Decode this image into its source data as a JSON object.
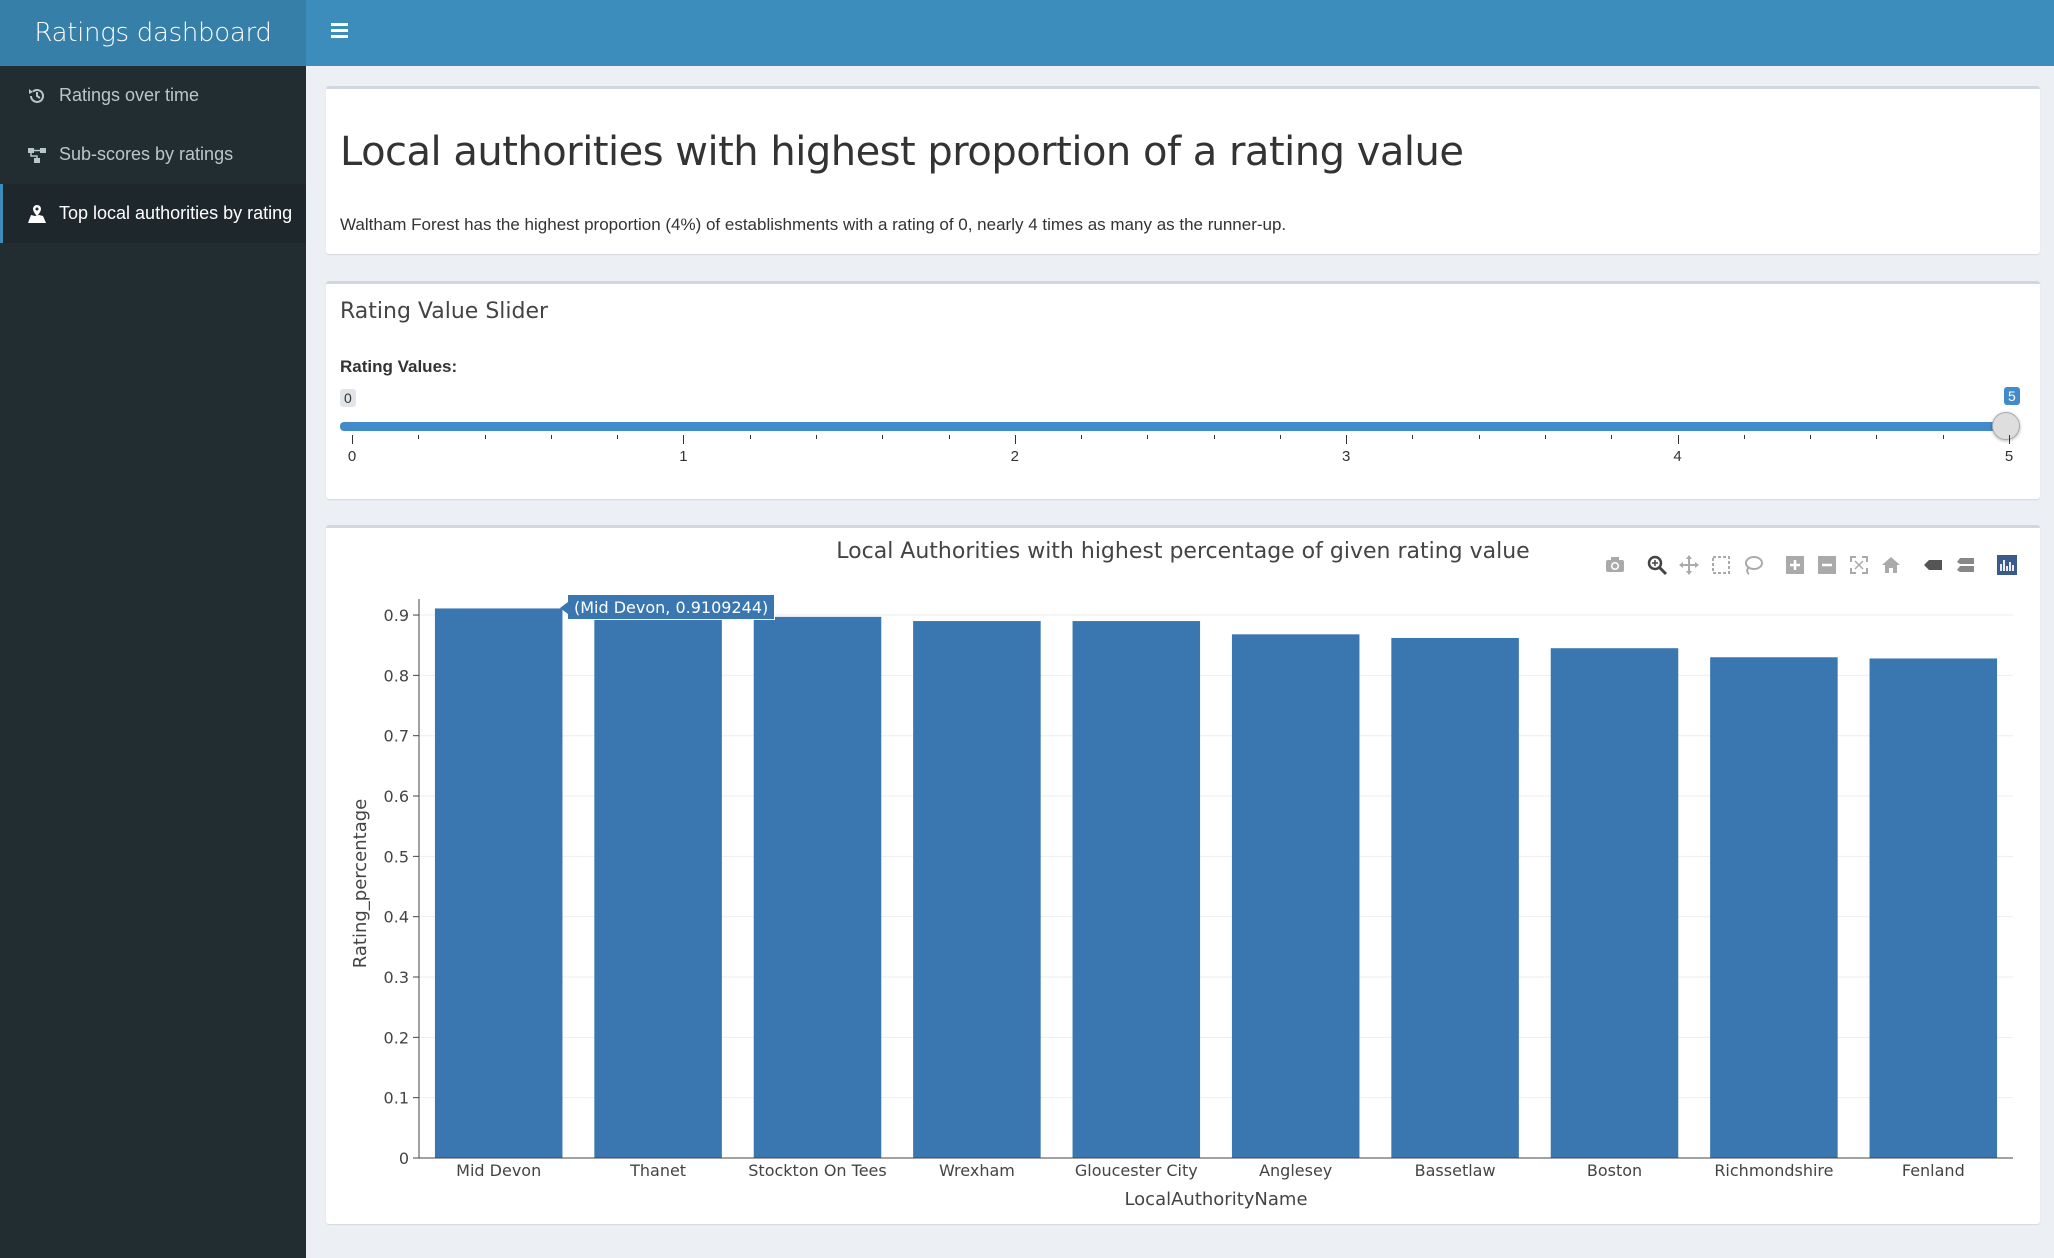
{
  "header": {
    "brand": "Ratings dashboard"
  },
  "sidebar": {
    "items": [
      {
        "label": "Ratings over time",
        "icon": "history-icon",
        "active": false
      },
      {
        "label": "Sub-scores by ratings",
        "icon": "sitemap-icon",
        "active": false
      },
      {
        "label": "Top local authorities by rating",
        "icon": "map-marked-icon",
        "active": true
      }
    ]
  },
  "intro": {
    "title": "Local authorities with highest proportion of a rating value",
    "summary": "Waltham Forest has the highest proportion (4%) of establishments with a rating of 0, nearly 4 times as many as the runner-up."
  },
  "slider": {
    "box_title": "Rating Value Slider",
    "label": "Rating Values:",
    "min_value": "0",
    "max_value": "5",
    "ticks": [
      "0",
      "1",
      "2",
      "3",
      "4",
      "5"
    ]
  },
  "tooltip": {
    "text": "(Mid Devon, 0.9109244)"
  },
  "colors": {
    "bar": "#3a76b0",
    "accent": "#3c8dbc",
    "sidebar": "#222d32"
  },
  "chart_data": {
    "type": "bar",
    "title": "Local Authorities with highest percentage of given rating value",
    "xlabel": "LocalAuthorityName",
    "ylabel": "Rating_percentage",
    "ylim": [
      0,
      0.91
    ],
    "yticks": [
      0,
      0.1,
      0.2,
      0.3,
      0.4,
      0.5,
      0.6,
      0.7,
      0.8,
      0.9
    ],
    "categories": [
      "Mid Devon",
      "Thanet",
      "Stockton On Tees",
      "Wrexham",
      "Gloucester City",
      "Anglesey",
      "Bassetlaw",
      "Boston",
      "Richmondshire",
      "Fenland"
    ],
    "values": [
      0.9109244,
      0.897,
      0.897,
      0.89,
      0.89,
      0.868,
      0.862,
      0.845,
      0.83,
      0.828
    ],
    "grid": true
  }
}
